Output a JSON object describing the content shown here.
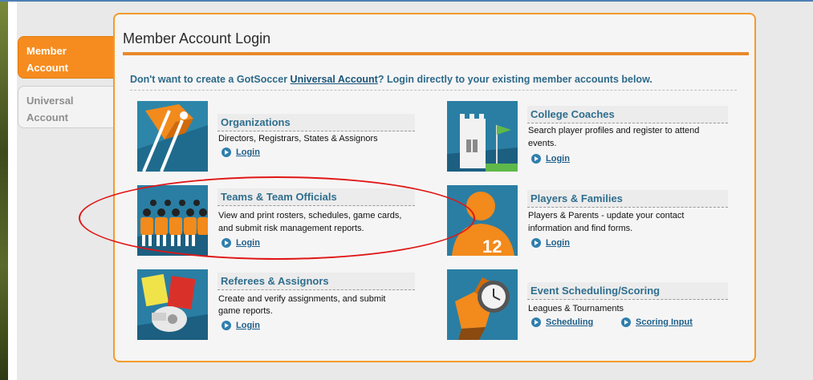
{
  "side_tabs": [
    {
      "label_1": "Member",
      "label_2": "Account",
      "active": true
    },
    {
      "label_1": "Universal",
      "label_2": "Account",
      "active": false
    }
  ],
  "panel": {
    "title": "Member Account Login",
    "intro_before": "Don't want to create a GotSoccer ",
    "intro_link": "Universal Account",
    "intro_after": "? Login directly to your existing member accounts below."
  },
  "cards": {
    "organizations": {
      "heading": "Organizations",
      "desc": "Directors, Registrars, States & Assignors",
      "link": "Login",
      "icon": "orange-flag-icon"
    },
    "teams": {
      "heading": "Teams & Team Officials",
      "desc_1": "View and print rosters, schedules, game cards,",
      "desc_2": "and submit risk management reports.",
      "link": "Login",
      "icon": "team-players-icon"
    },
    "referees": {
      "heading": "Referees & Assignors",
      "desc_1": "Create and verify assignments, and submit",
      "desc_2": "game reports.",
      "link": "Login",
      "icon": "whistle-cards-icon"
    },
    "college": {
      "heading": "College Coaches",
      "desc_1": "Search player profiles and register to attend",
      "desc_2": "events.",
      "link": "Login",
      "icon": "college-building-icon"
    },
    "players": {
      "heading": "Players & Families",
      "desc_1": "Players & Parents - update your contact",
      "desc_2": "information and find forms.",
      "link": "Login",
      "icon": "player-12-icon",
      "jersey_number": "12"
    },
    "events": {
      "heading": "Event Scheduling/Scoring",
      "desc": "Leagues & Tournaments",
      "link_1": "Scheduling",
      "link_2": "Scoring Input",
      "icon": "ball-clock-icon"
    }
  },
  "colors": {
    "accent_orange": "#f68c1f",
    "heading_blue": "#2f6e8e",
    "annotation_red": "#e01616"
  }
}
